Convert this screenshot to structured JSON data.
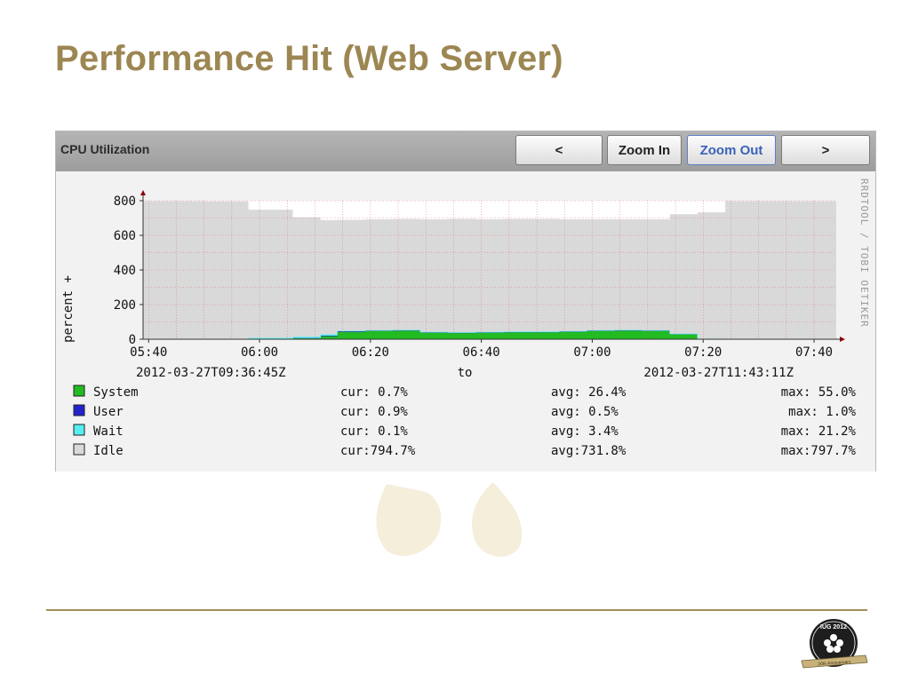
{
  "slide": {
    "title": "Performance Hit (Web Server)"
  },
  "panel": {
    "title": "CPU Utilization",
    "buttons": [
      {
        "label": "<"
      },
      {
        "label": "Zoom In"
      },
      {
        "label": "Zoom Out",
        "active": true
      },
      {
        "label": ">"
      }
    ]
  },
  "chart_data": {
    "type": "area",
    "stacked": true,
    "ylabel": "percent +",
    "watermark": "RRDTOOL / TOBI OETIKER",
    "ylim": [
      0,
      800
    ],
    "y_ticks": [
      "0",
      "200",
      "400",
      "600",
      "800"
    ],
    "x_ticks": [
      "05:40",
      "06:00",
      "06:20",
      "06:40",
      "07:00",
      "07:20",
      "07:40"
    ],
    "x_tick_minutes": [
      340,
      360,
      380,
      400,
      420,
      440,
      460
    ],
    "xlim_minutes": [
      339,
      464
    ],
    "x_start_label": "2012-03-27T09:36:45Z",
    "to_label": "to",
    "x_end_label": "2012-03-27T11:43:11Z",
    "grid": true,
    "colors": {
      "System": "#22bb22",
      "User": "#2222cc",
      "Wait": "#55eeee",
      "Idle": "#d9d9d9",
      "background": "#ffffff",
      "grid": "#e06060",
      "axis": "#8b0000"
    },
    "x_minutes": [
      339,
      350,
      358,
      366,
      371,
      374,
      379,
      384,
      389,
      394,
      399,
      404,
      409,
      414,
      419,
      424,
      429,
      434,
      439,
      444,
      449,
      454,
      459,
      464
    ],
    "series": [
      {
        "name": "System",
        "values": [
          0,
          0,
          2,
          8,
          20,
          45,
          50,
          52,
          40,
          38,
          40,
          42,
          42,
          45,
          50,
          52,
          50,
          30,
          2,
          0,
          0,
          0,
          0,
          0
        ]
      },
      {
        "name": "User",
        "values": [
          1,
          1,
          1,
          1,
          3,
          3,
          1,
          1,
          1,
          1,
          1,
          1,
          1,
          1,
          1,
          1,
          1,
          1,
          1,
          1,
          1,
          1,
          1,
          1
        ]
      },
      {
        "name": "Wait",
        "values": [
          0,
          0,
          5,
          5,
          5,
          1,
          1,
          1,
          1,
          1,
          1,
          1,
          1,
          1,
          1,
          1,
          1,
          1,
          0,
          0,
          0,
          0,
          0,
          0
        ]
      },
      {
        "name": "Idle",
        "values": [
          797,
          796,
          740,
          690,
          660,
          640,
          640,
          640,
          650,
          655,
          650,
          650,
          650,
          645,
          640,
          638,
          640,
          690,
          730,
          797,
          797,
          797,
          797,
          797
        ]
      }
    ],
    "legend": [
      {
        "name": "System",
        "cur": "cur:  0.7%",
        "avg": "avg: 26.4%",
        "max": "max: 55.0%"
      },
      {
        "name": "User",
        "cur": "cur:  0.9%",
        "avg": "avg:  0.5%",
        "max": "max:  1.0%"
      },
      {
        "name": "Wait",
        "cur": "cur:  0.1%",
        "avg": "avg:  3.4%",
        "max": "max: 21.2%"
      },
      {
        "name": "Idle",
        "cur": "cur:794.7%",
        "avg": "avg:731.8%",
        "max": "max:797.7%"
      }
    ]
  },
  "footer": {
    "logo_text": "IUG 2012",
    "logo_ribbon": "20th Anniversary"
  }
}
